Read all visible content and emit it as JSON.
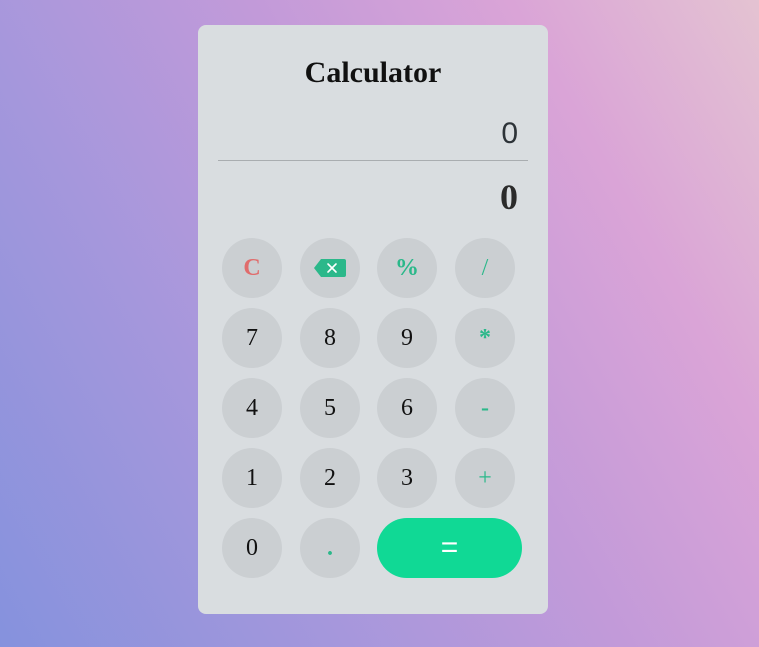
{
  "app": {
    "title": "Calculator"
  },
  "display": {
    "expression": "0",
    "result": "0"
  },
  "keys": {
    "clear": "C",
    "backspace_icon": "backspace-icon",
    "percent": "%",
    "divide": "/",
    "seven": "7",
    "eight": "8",
    "nine": "9",
    "multiply": "*",
    "four": "4",
    "five": "5",
    "six": "6",
    "subtract": "-",
    "one": "1",
    "two": "2",
    "three": "3",
    "add": "+",
    "zero": "0",
    "decimal": ".",
    "equals": "="
  },
  "colors": {
    "accent": "#10d995",
    "operator": "#2bb88a",
    "clear": "#e06c6c",
    "card": "#d9dde0",
    "key": "#cbcfd2"
  }
}
